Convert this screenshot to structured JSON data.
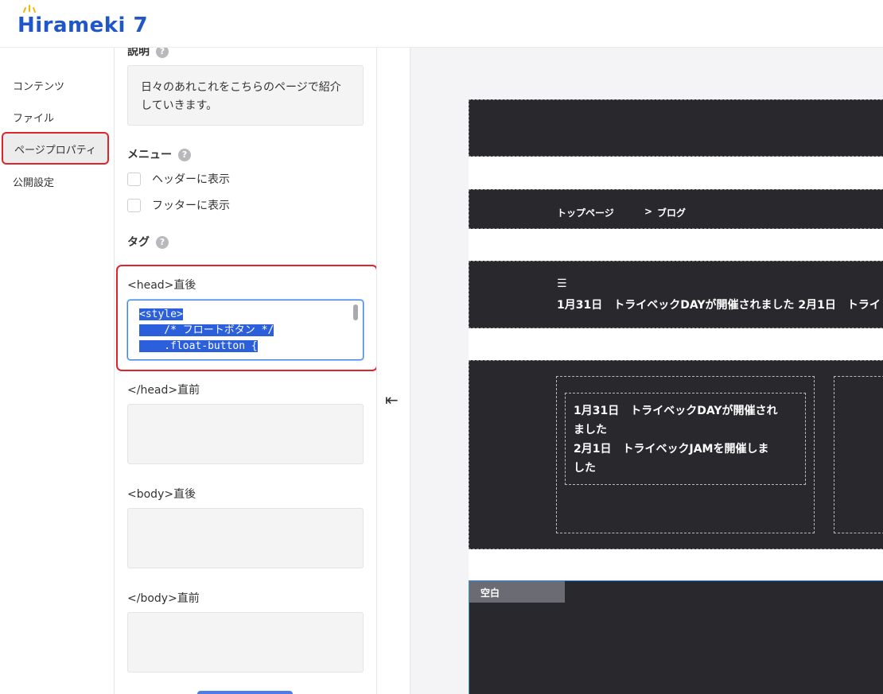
{
  "app": {
    "logo_text": "Hirameki 7",
    "logo_color": "#1f57c8"
  },
  "nav": {
    "items": [
      {
        "label": "コンテンツ"
      },
      {
        "label": "ファイル"
      },
      {
        "label": "ページプロパティ"
      },
      {
        "label": "公開設定"
      }
    ],
    "active_index": 2
  },
  "panel": {
    "description": {
      "label": "説明",
      "value": "日々のあれこれをこちらのページで紹介していきます。"
    },
    "menu": {
      "label": "メニュー",
      "header_option": "ヘッダーに表示",
      "footer_option": "フッターに表示"
    },
    "tags": {
      "label": "タグ",
      "head_start": {
        "label": "<head>直後",
        "code_lines": [
          "<style>",
          "    /* フロートボタン */",
          "    .float-button {"
        ]
      },
      "head_end": {
        "label": "</head>直前",
        "value": ""
      },
      "body_start": {
        "label": "<body>直後",
        "value": ""
      },
      "body_end": {
        "label": "</body>直前",
        "value": ""
      }
    },
    "help_glyph": "?"
  },
  "collapse": {
    "icon": "⇤"
  },
  "preview": {
    "breadcrumb": {
      "home": "トップページ",
      "separator": ">",
      "current": "ブログ"
    },
    "ticker": {
      "icon": "☰",
      "text": "1月31日　トライベックDAYが開催されました 2月1日　トライ"
    },
    "news": {
      "line1": "1月31日　トライベックDAYが開催され",
      "line2": "ました",
      "line3": "2月1日　トライベックJAMを開催しま",
      "line4": "した"
    },
    "blank_label": "空白"
  },
  "colors": {
    "highlight_red": "#e0242d",
    "focus_blue": "#3b86e8",
    "dark_block": "#29292d",
    "selection": "#2c5fdc"
  }
}
